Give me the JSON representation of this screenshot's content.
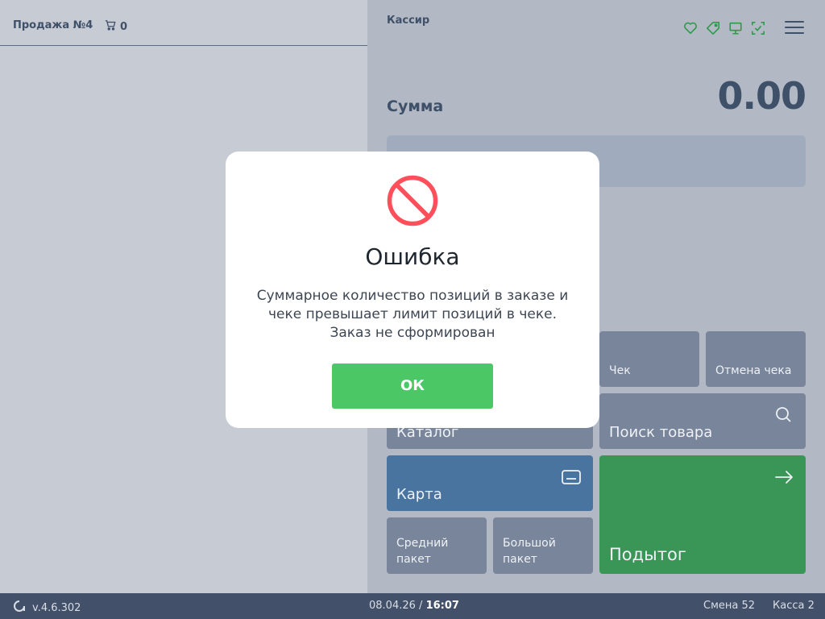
{
  "left": {
    "sale_title": "Продажа №4",
    "cart_count": "0"
  },
  "right": {
    "cashier": "Кассир",
    "sum_label": "Сумма",
    "sum_value": "0.00"
  },
  "status_icons": [
    "heart-icon",
    "tag-icon",
    "monitor-icon",
    "scan-icon"
  ],
  "colors": {
    "status_green": "#2f9a4b",
    "ok_green": "#4cc766",
    "subtotal_green": "#3a9657",
    "card_blue": "#4a74a0",
    "error_red": "#ff4f5b"
  },
  "tiles": {
    "check": "Чек",
    "cancel_check": "Отмена чека",
    "catalog": "Каталог",
    "search": "Поиск товара",
    "card": "Карта",
    "medium_bag": "Средний пакет",
    "large_bag": "Большой пакет",
    "subtotal": "Подытог"
  },
  "bottom": {
    "version": "v.4.6.302",
    "date": "08.04.26",
    "separator": "/",
    "time": "16:07",
    "shift": "Смена 52",
    "kassa": "Касса 2"
  },
  "modal": {
    "title": "Ошибка",
    "message_line1": "Суммарное количество позиций в заказе и",
    "message_line2": "чеке превышает лимит позиций в чеке.",
    "message_line3": "Заказ не сформирован",
    "ok_label": "ОК"
  }
}
